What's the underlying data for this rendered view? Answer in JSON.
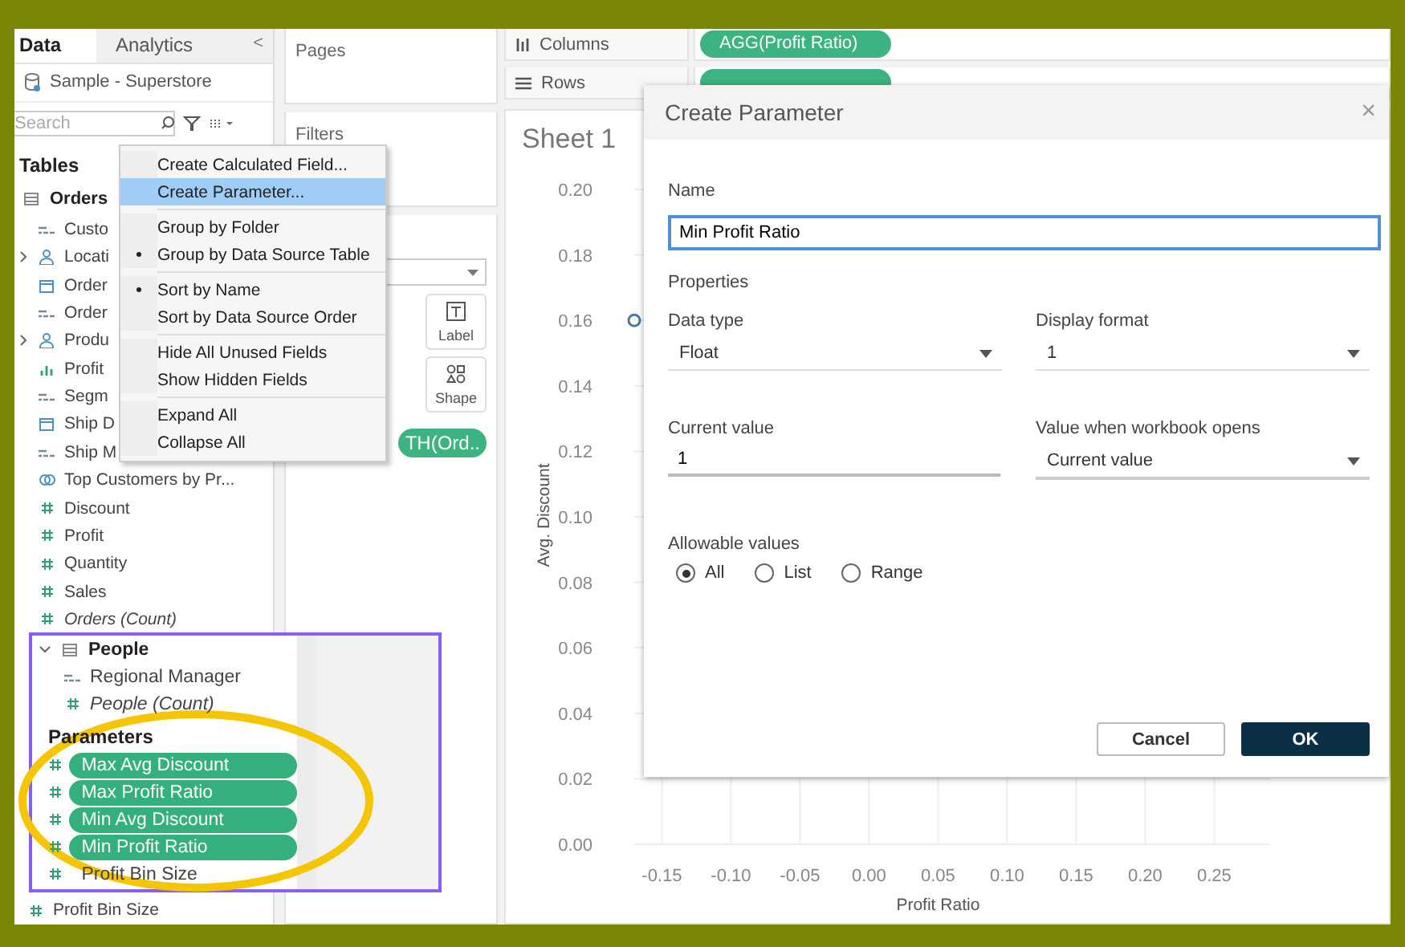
{
  "left_panel": {
    "tabs": [
      {
        "label": "Data",
        "selected": true
      },
      {
        "label": "Analytics",
        "selected": false
      }
    ],
    "collapse_glyph": "<",
    "data_source": "Sample - Superstore",
    "search": {
      "placeholder": "Search"
    },
    "section_title": "Tables",
    "table": {
      "name": "Orders",
      "fields": [
        {
          "name": "Custo",
          "kind": "text",
          "generated": false
        },
        {
          "name": "Locati",
          "kind": "hierarchy",
          "generated": false
        },
        {
          "name": "Order",
          "kind": "date",
          "generated": false
        },
        {
          "name": "Order",
          "kind": "text",
          "generated": false
        },
        {
          "name": "Produ",
          "kind": "hierarchy",
          "generated": false
        },
        {
          "name": "Profit",
          "kind": "bin",
          "generated": false
        },
        {
          "name": "Segm",
          "kind": "text",
          "generated": false
        },
        {
          "name": "Ship D",
          "kind": "date",
          "generated": false
        },
        {
          "name": "Ship M",
          "kind": "text",
          "generated": false
        },
        {
          "name": "Top Customers by Pr...",
          "kind": "set",
          "generated": false
        },
        {
          "name": "Discount",
          "kind": "measure",
          "generated": false
        },
        {
          "name": "Profit",
          "kind": "measure",
          "generated": false
        },
        {
          "name": "Quantity",
          "kind": "measure",
          "generated": false
        },
        {
          "name": "Sales",
          "kind": "measure",
          "generated": false
        },
        {
          "name": "Orders (Count)",
          "kind": "measure",
          "generated": true
        }
      ]
    },
    "fields_below": [
      {
        "name": "Profit Bin Size",
        "kind": "measure",
        "generated": false
      }
    ]
  },
  "context_menu": {
    "sections": [
      {
        "items": [
          {
            "label": "Create Calculated Field...",
            "selected": false,
            "checked": false
          },
          {
            "label": "Create Parameter...",
            "selected": true,
            "checked": false
          }
        ]
      },
      {
        "items": [
          {
            "label": "Group by Folder",
            "selected": false,
            "checked": false
          },
          {
            "label": "Group by Data Source Table",
            "selected": false,
            "checked": true
          }
        ]
      },
      {
        "items": [
          {
            "label": "Sort by Name",
            "selected": false,
            "checked": true
          },
          {
            "label": "Sort by Data Source Order",
            "selected": false,
            "checked": false
          }
        ]
      },
      {
        "items": [
          {
            "label": "Hide All Unused Fields",
            "selected": false,
            "checked": false
          },
          {
            "label": "Show Hidden Fields",
            "selected": false,
            "checked": false
          }
        ]
      },
      {
        "items": [
          {
            "label": "Expand All",
            "selected": false,
            "checked": false
          },
          {
            "label": "Collapse All",
            "selected": false,
            "checked": false
          }
        ]
      }
    ]
  },
  "cards": {
    "pages": "Pages",
    "filters": "Filters",
    "marks": {
      "buttons": [
        {
          "label": "Label",
          "kind": "label"
        },
        {
          "label": "Shape",
          "kind": "shape"
        }
      ],
      "pill": "TH(Ord.."
    }
  },
  "columns_shelf": {
    "label": "Columns",
    "pill": "AGG(Profit Ratio)"
  },
  "rows_shelf": {
    "label": "Rows"
  },
  "sheet": {
    "title": "Sheet 1",
    "chart_data": {
      "type": "scatter",
      "xlabel": "Profit Ratio",
      "ylabel": "Avg. Discount",
      "x": [
        -0.17
      ],
      "values": [
        0.16
      ],
      "xlim": [
        -0.17,
        0.29
      ],
      "ylim": [
        0,
        0.2
      ],
      "grid": true,
      "xticks": [
        {
          "value": -0.15,
          "label": "-0.15"
        },
        {
          "value": -0.1,
          "label": "-0.10"
        },
        {
          "value": -0.05,
          "label": "-0.05"
        },
        {
          "value": 0,
          "label": "0.00"
        },
        {
          "value": 0.05,
          "label": "0.05"
        },
        {
          "value": 0.1,
          "label": "0.10"
        },
        {
          "value": 0.15,
          "label": "0.15"
        },
        {
          "value": 0.2,
          "label": "0.20"
        },
        {
          "value": 0.25,
          "label": "0.25"
        }
      ],
      "yticks": [
        {
          "value": 0,
          "label": "0.00"
        },
        {
          "value": 0.02,
          "label": "0.02"
        },
        {
          "value": 0.04,
          "label": "0.04"
        },
        {
          "value": 0.06,
          "label": "0.06"
        },
        {
          "value": 0.08,
          "label": "0.08"
        },
        {
          "value": 0.1,
          "label": "0.10"
        },
        {
          "value": 0.12,
          "label": "0.12"
        },
        {
          "value": 0.14,
          "label": "0.14"
        },
        {
          "value": 0.16,
          "label": "0.16"
        },
        {
          "value": 0.18,
          "label": "0.18"
        },
        {
          "value": 0.2,
          "label": "0.20"
        }
      ]
    }
  },
  "inset": {
    "table": {
      "name": "People",
      "expanded": true,
      "fields": [
        {
          "name": "Regional Manager",
          "kind": "text",
          "generated": false
        },
        {
          "name": "People (Count)",
          "kind": "measure",
          "generated": true
        }
      ]
    },
    "parameters_title": "Parameters",
    "parameters": [
      {
        "name": "Max Avg Discount",
        "selected": true
      },
      {
        "name": "Max Profit Ratio",
        "selected": true
      },
      {
        "name": "Min Avg Discount",
        "selected": true
      },
      {
        "name": "Min Profit Ratio",
        "selected": true
      },
      {
        "name": "Profit Bin Size",
        "selected": false
      }
    ]
  },
  "dialog": {
    "title": "Create Parameter",
    "close_glyph": "×",
    "name_label": "Name",
    "name_value": "Min Profit Ratio",
    "name_focused": true,
    "properties_label": "Properties",
    "fields": [
      {
        "label": "Data type",
        "value": "Float",
        "kind": "dropdown"
      },
      {
        "label": "Display format",
        "value": "1",
        "kind": "dropdown"
      },
      {
        "label": "Current value",
        "value": "1",
        "kind": "input"
      },
      {
        "label": "Value when workbook opens",
        "value": "Current value",
        "kind": "dropdown"
      }
    ],
    "allowable_label": "Allowable values",
    "options": [
      {
        "label": "All",
        "selected": true
      },
      {
        "label": "List",
        "selected": false
      },
      {
        "label": "Range",
        "selected": false
      }
    ],
    "buttons": [
      {
        "label": "Cancel",
        "kind": "secondary"
      },
      {
        "label": "OK",
        "kind": "primary"
      }
    ]
  }
}
